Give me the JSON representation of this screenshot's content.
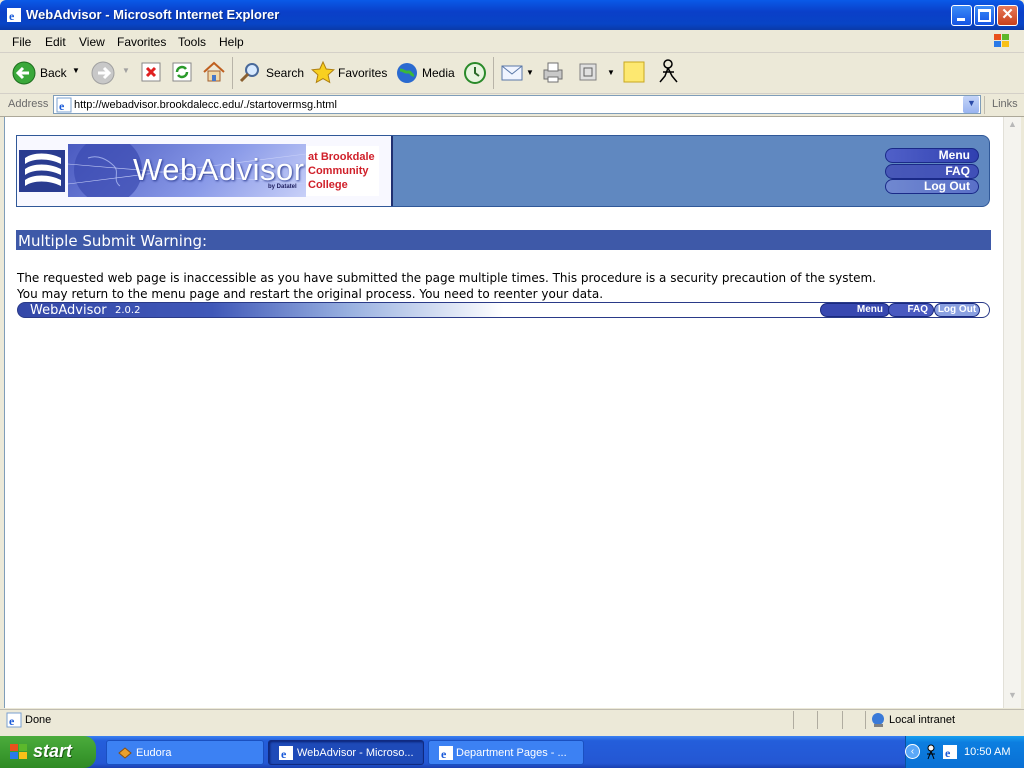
{
  "window": {
    "title": "WebAdvisor - Microsoft Internet Explorer"
  },
  "menubar": {
    "items": [
      "File",
      "Edit",
      "View",
      "Favorites",
      "Tools",
      "Help"
    ]
  },
  "toolbar": {
    "back": "Back",
    "search": "Search",
    "favorites": "Favorites",
    "media": "Media"
  },
  "address": {
    "label": "Address",
    "url": "http://webadvisor.brookdalecc.edu/./startovermsg.html",
    "links": "Links"
  },
  "page": {
    "logo": {
      "main": "WebAdvisor",
      "by": "by Datatel",
      "college_lines": [
        "at Brookdale",
        "Community",
        "College"
      ]
    },
    "nav": {
      "menu": "Menu",
      "faq": "FAQ",
      "logout": "Log Out"
    },
    "warning_title": "Multiple Submit Warning:",
    "message_line1": "The requested web page is inaccessible as you have submitted the page multiple times. This procedure is a security precaution of the system.",
    "message_line2": "You may return to the menu page and restart the original process. You need to reenter your data.",
    "footer": {
      "brand": "WebAdvisor",
      "version": "2.0.2",
      "menu": "Menu",
      "faq": "FAQ",
      "logout": "Log Out"
    }
  },
  "status": {
    "text": "Done",
    "zone": "Local intranet"
  },
  "taskbar": {
    "start": "start",
    "tasks": [
      "Eudora",
      "WebAdvisor - Microso...",
      "Department Pages - ..."
    ],
    "clock": "10:50 AM"
  },
  "colors": {
    "ie_blue": "#0a3fc8",
    "header_bg": "#6088c0",
    "warning_bar": "#3e59a8",
    "start_green": "#3c9c30"
  }
}
